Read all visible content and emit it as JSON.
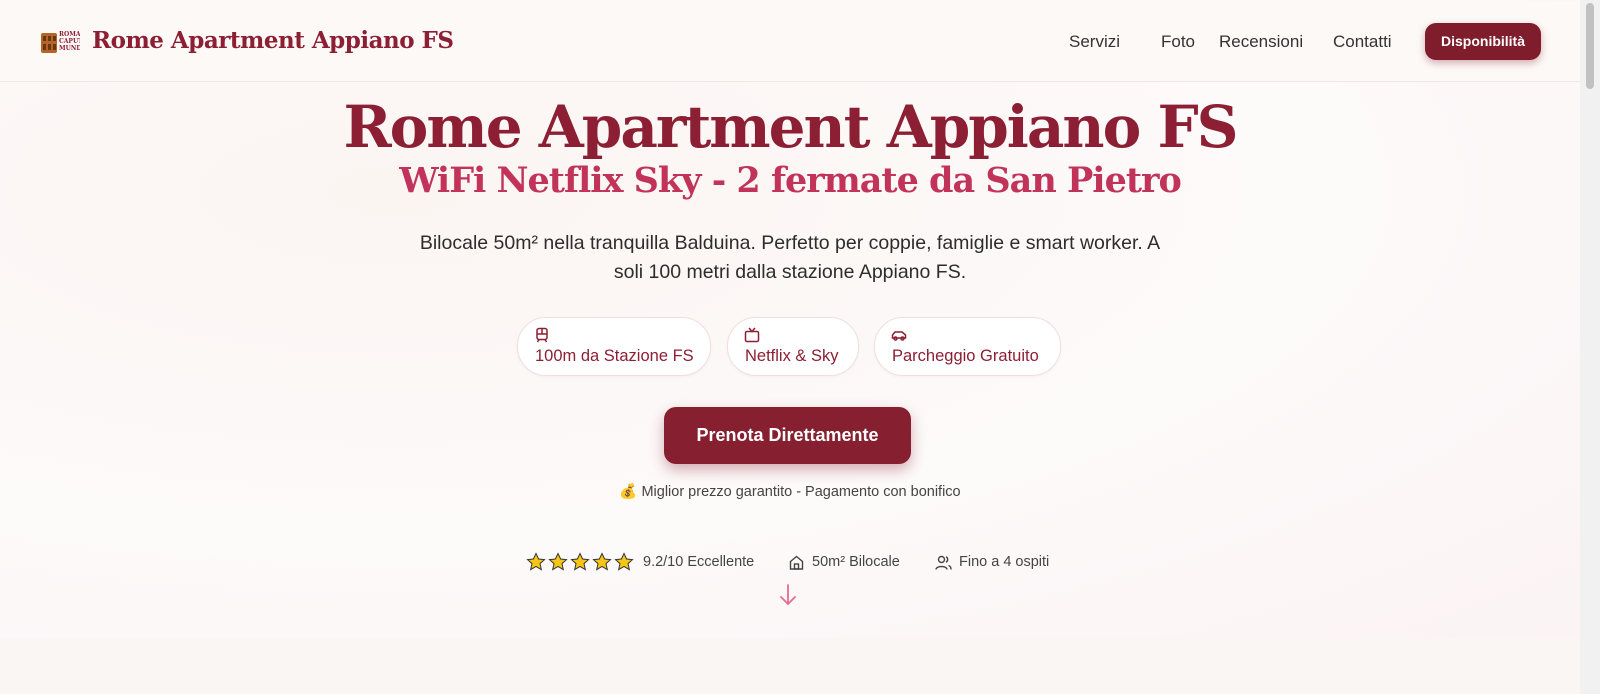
{
  "header": {
    "brand": "Rome Apartment Appiano FS",
    "logo_text": "ROMA CAPVT MVNDI",
    "nav": [
      "Servizi",
      "Foto",
      "Recensioni",
      "Contatti"
    ],
    "cta": "Disponibilità"
  },
  "hero": {
    "title": "Rome Apartment Appiano FS",
    "subtitle": "WiFi Netflix Sky - 2 fermate da San Pietro",
    "description": "Bilocale 50m² nella tranquilla Balduina. Perfetto per coppie, famiglie e smart worker. A soli 100 metri dalla stazione Appiano FS.",
    "chips": [
      {
        "label": "100m da Stazione FS",
        "icon": "train-icon"
      },
      {
        "label": "Netflix & Sky",
        "icon": "tv-icon"
      },
      {
        "label": "Parcheggio Gratuito",
        "icon": "car-icon"
      }
    ],
    "cta": "Prenota Direttamente",
    "price_note": "Miglior prezzo garantito - Pagamento con bonifico",
    "price_icon": "money-bag-icon"
  },
  "stats": {
    "stars": 5,
    "rating": "9.2/10 Eccellente",
    "size": "50m² Bilocale",
    "guests": "Fino a 4 ospiti"
  },
  "colors": {
    "primary": "#8c1f33",
    "accent": "#c2335a",
    "star": "#f5c518",
    "arrow": "#e56b8f"
  }
}
